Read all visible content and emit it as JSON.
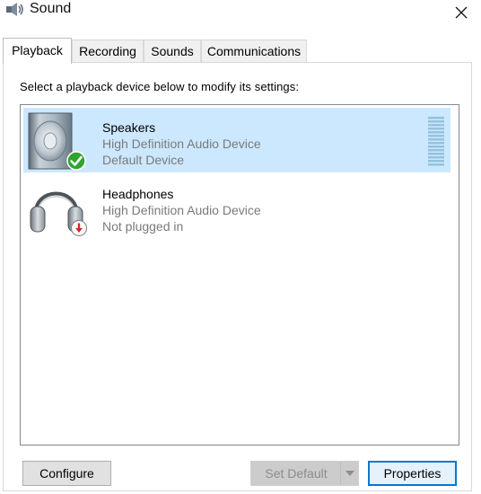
{
  "window": {
    "title": "Sound"
  },
  "tabs": [
    {
      "label": "Playback",
      "active": true
    },
    {
      "label": "Recording",
      "active": false
    },
    {
      "label": "Sounds",
      "active": false
    },
    {
      "label": "Communications",
      "active": false
    }
  ],
  "playback": {
    "instruction": "Select a playback device below to modify its settings:",
    "devices": [
      {
        "name": "Speakers",
        "description": "High Definition Audio Device",
        "status": "Default Device",
        "selected": true,
        "icon": "speaker-icon",
        "badge": "default-check-icon"
      },
      {
        "name": "Headphones",
        "description": "High Definition Audio Device",
        "status": "Not plugged in",
        "selected": false,
        "icon": "headphones-icon",
        "badge": "unplugged-icon"
      }
    ]
  },
  "buttons": {
    "configure": "Configure",
    "set_default": "Set Default",
    "properties": "Properties"
  },
  "colors": {
    "selection": "#cce8ff",
    "accent": "#0078d7",
    "check": "#2fa52f",
    "unplugged": "#d72828"
  }
}
